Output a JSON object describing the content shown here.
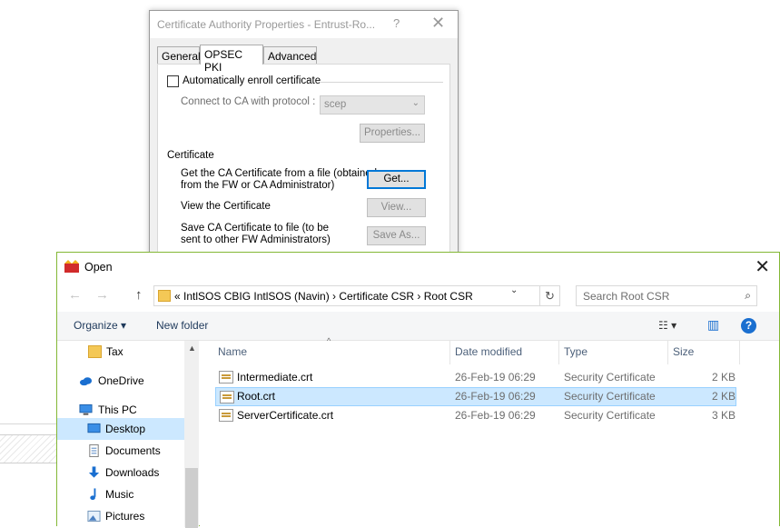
{
  "ca_dialog": {
    "title": "Certificate Authority Properties - Entrust-Ro...",
    "help_glyph": "?",
    "close_glyph": "✕",
    "tabs": [
      {
        "label": "General",
        "active": false
      },
      {
        "label": "OPSEC PKI",
        "active": true
      },
      {
        "label": "Advanced",
        "active": false
      }
    ],
    "auto_enroll_label": "Automatically enroll certificate",
    "auto_enroll_checked": false,
    "protocol_label": "Connect to CA with protocol :",
    "protocol_value": "scep",
    "properties_button": "Properties...",
    "certificate_section": "Certificate",
    "get_desc_line1": "Get the CA Certificate from a file (obtained",
    "get_desc_line2": "from the FW or CA Administrator)",
    "get_button": "Get...",
    "view_desc": "View the Certificate",
    "view_button": "View...",
    "save_desc_line1": "Save CA Certificate to file (to be",
    "save_desc_line2": "sent to other FW Administrators)",
    "save_button": "Save As..."
  },
  "open_dialog": {
    "title": "Open",
    "close_glyph": "✕",
    "back_glyph": "←",
    "forward_glyph": "→",
    "up_glyph": "↑",
    "address_path": "«  IntlSOS CBIG IntlSOS (Navin)  ›  Certificate CSR  ›  Root CSR",
    "dropdown_glyph": "⌄",
    "refresh_glyph": "↻",
    "search_placeholder": "Search Root CSR",
    "search_glyph": "⌕",
    "organize_label": "Organize ▾",
    "new_folder_label": "New folder",
    "view_glyph": "☷ ▾",
    "pane_glyph": "▥",
    "help_glyph": "?",
    "nav_items": [
      {
        "label": "Tax",
        "icon": "folder-icon"
      },
      {
        "label": "OneDrive",
        "icon": "cloud-icon"
      },
      {
        "label": "This PC",
        "icon": "computer-icon"
      },
      {
        "label": "Desktop",
        "icon": "desktop-icon"
      },
      {
        "label": "Documents",
        "icon": "documents-icon"
      },
      {
        "label": "Downloads",
        "icon": "download-icon"
      },
      {
        "label": "Music",
        "icon": "music-icon"
      },
      {
        "label": "Pictures",
        "icon": "pictures-icon"
      }
    ],
    "scroll_up_glyph": "▲",
    "columns": {
      "name": "Name",
      "date": "Date modified",
      "type": "Type",
      "size": "Size",
      "sort_glyph": "^"
    },
    "files": [
      {
        "name": "Intermediate.crt",
        "date": "26-Feb-19 06:29",
        "type": "Security Certificate",
        "size": "2 KB"
      },
      {
        "name": "Root.crt",
        "date": "26-Feb-19 06:29",
        "type": "Security Certificate",
        "size": "2 KB"
      },
      {
        "name": "ServerCertificate.crt",
        "date": "26-Feb-19 06:29",
        "type": "Security Certificate",
        "size": "3 KB"
      }
    ],
    "selected_file_index": 1,
    "accent_color": "#83b735",
    "selection_color": "#cce8ff"
  }
}
